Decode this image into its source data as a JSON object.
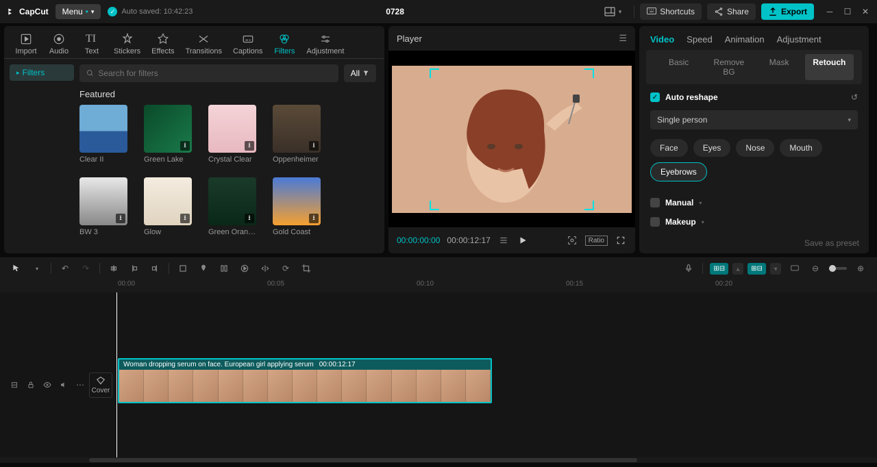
{
  "app": {
    "name": "CapCut",
    "menu": "Menu",
    "autosave": "Auto saved: 10:42:23",
    "title": "0728"
  },
  "topbar": {
    "shortcuts": "Shortcuts",
    "share": "Share",
    "export": "Export"
  },
  "tools": {
    "items": [
      {
        "label": "Import"
      },
      {
        "label": "Audio"
      },
      {
        "label": "Text"
      },
      {
        "label": "Stickers"
      },
      {
        "label": "Effects"
      },
      {
        "label": "Transitions"
      },
      {
        "label": "Captions"
      },
      {
        "label": "Filters"
      },
      {
        "label": "Adjustment"
      }
    ],
    "active_index": 7
  },
  "sidebar": {
    "filters": "Filters"
  },
  "filters_panel": {
    "search_placeholder": "Search for filters",
    "all": "All",
    "featured": "Featured",
    "items": [
      {
        "label": "Clear II",
        "grad": "linear-gradient(#6facd6 55%,#2a5a9a 55%)"
      },
      {
        "label": "Green Lake",
        "grad": "linear-gradient(135deg,#0a4a2a,#1a7a4a)"
      },
      {
        "label": "Crystal Clear",
        "grad": "linear-gradient(#f4d4d8,#e8b8c0)"
      },
      {
        "label": "Oppenheimer",
        "grad": "linear-gradient(#5a4a38,#3a3028)"
      },
      {
        "label": "BW 3",
        "grad": "linear-gradient(#e8e8e8,#888)"
      },
      {
        "label": "Glow",
        "grad": "linear-gradient(#f4ece0,#e0d4c0)"
      },
      {
        "label": "Green Orange",
        "grad": "linear-gradient(#1a3a2a,#0a2818)"
      },
      {
        "label": "Gold Coast",
        "grad": "linear-gradient(#4a7ad6,#f6a030)"
      }
    ]
  },
  "player": {
    "title": "Player",
    "current": "00:00:00:00",
    "total": "00:00:12:17",
    "ratio": "Ratio"
  },
  "right": {
    "tabs": [
      "Video",
      "Speed",
      "Animation",
      "Adjustment"
    ],
    "subtabs": [
      "Basic",
      "Remove BG",
      "Mask",
      "Retouch"
    ],
    "auto_reshape": "Auto reshape",
    "person_select": "Single person",
    "face_parts": [
      "Face",
      "Eyes",
      "Nose",
      "Mouth",
      "Eyebrows"
    ],
    "active_part_index": 4,
    "manual": "Manual",
    "makeup": "Makeup",
    "save_preset": "Save as preset"
  },
  "timeline": {
    "ticks": [
      "00:00",
      "00:05",
      "00:10",
      "00:15",
      "00:20"
    ],
    "cover": "Cover",
    "clip_title": "Woman dropping serum on face. European girl applying serum",
    "clip_duration": "00:00:12:17"
  }
}
